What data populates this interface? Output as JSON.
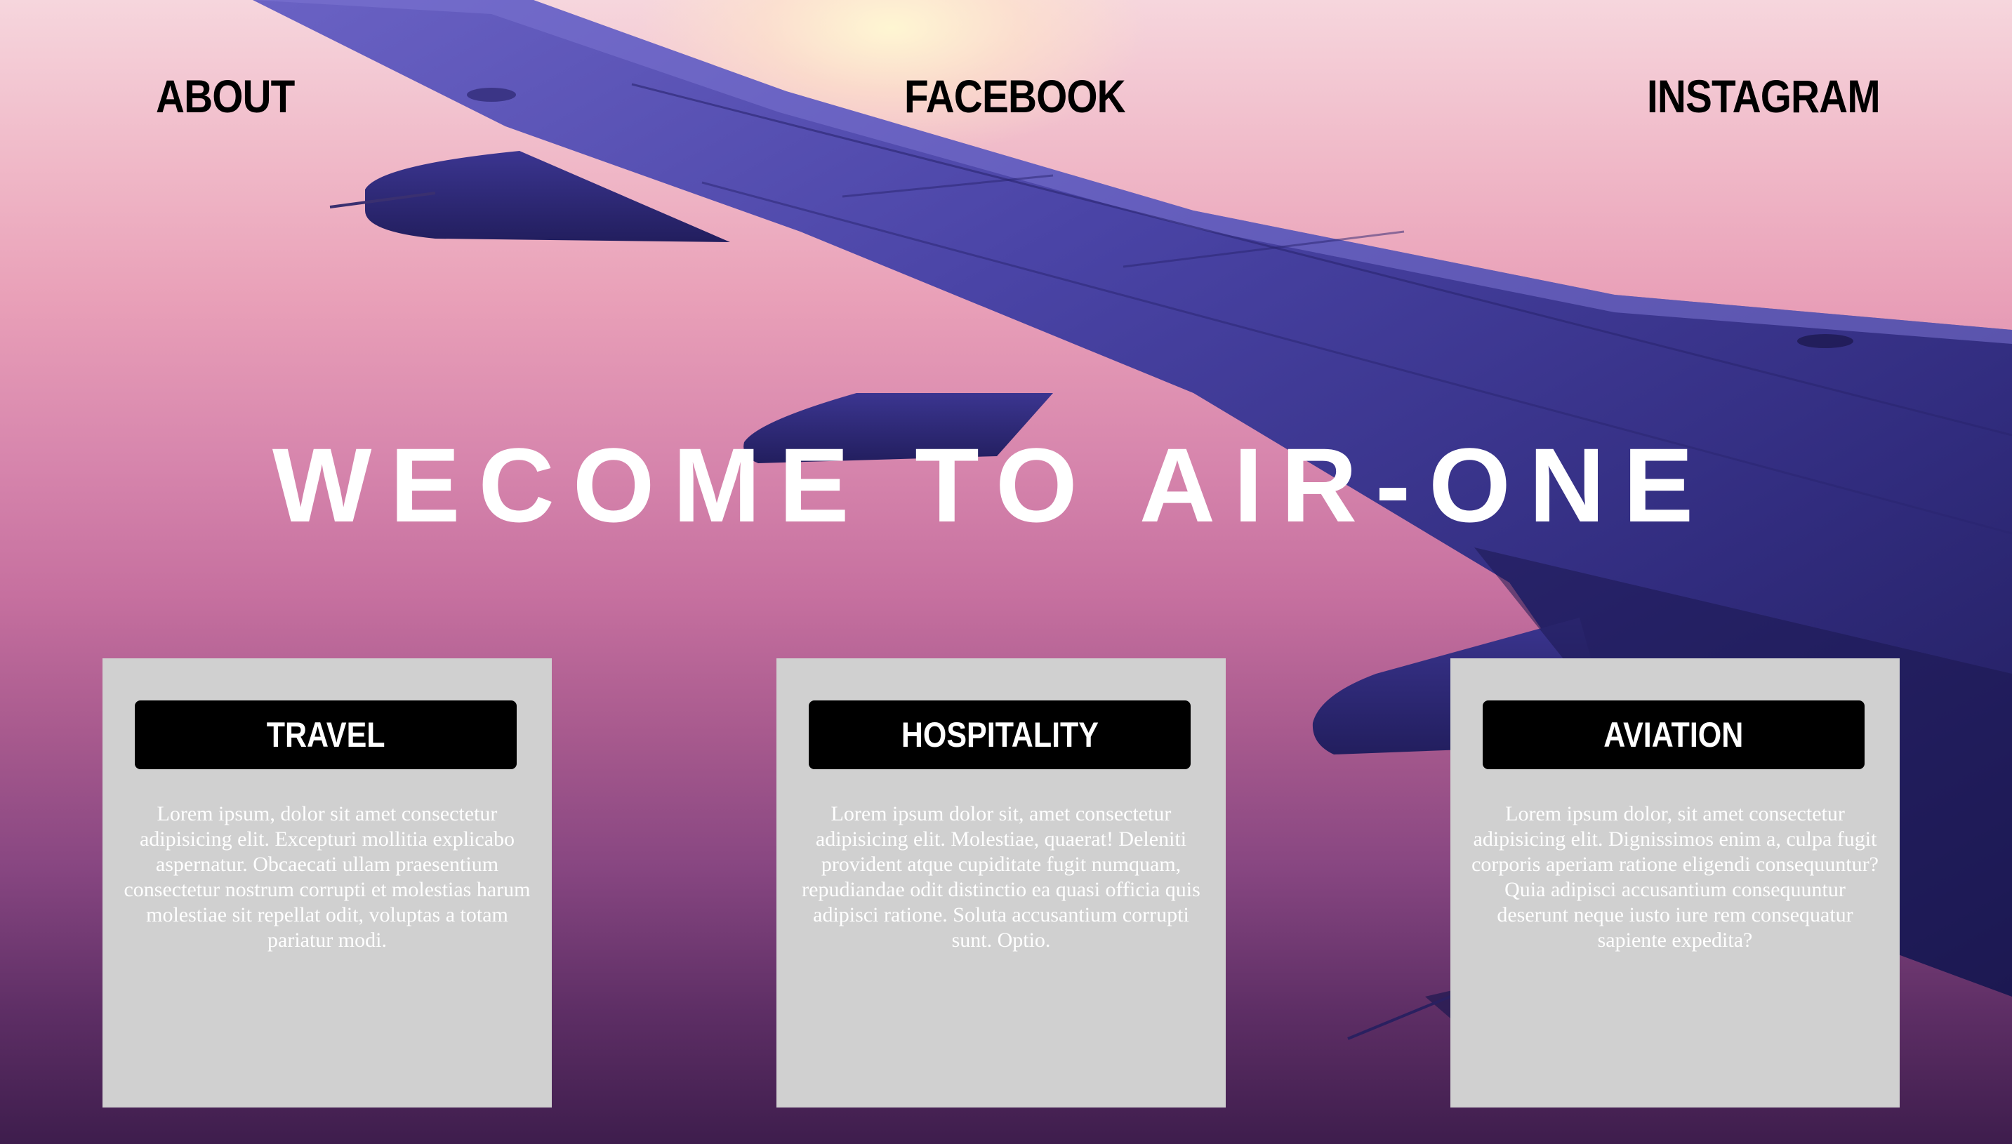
{
  "nav": {
    "about": "ABOUT",
    "facebook": "FACEBOOK",
    "instagram": "INSTAGRAM"
  },
  "hero": {
    "title": "WECOME TO AIR-ONE",
    "background_image": "airplane-wing-sunset"
  },
  "cards": [
    {
      "button_label": "TRAVEL",
      "text": "Lorem ipsum, dolor sit amet consectetur adipisicing elit. Excepturi mollitia explicabo aspernatur. Obcaecati ullam praesentium consectetur nostrum corrupti et molestias harum molestiae sit repellat odit, voluptas a totam pariatur modi."
    },
    {
      "button_label": "HOSPITALITY",
      "text": "Lorem ipsum dolor sit, amet consectetur adipisicing elit. Molestiae, quaerat! Deleniti provident atque cupiditate fugit numquam, repudiandae odit distinctio ea quasi officia quis adipisci ratione. Soluta accusantium corrupti sunt. Optio."
    },
    {
      "button_label": "AVIATION",
      "text": "Lorem ipsum dolor, sit amet consectetur adipisicing elit. Dignissimos enim a, culpa fugit corporis aperiam ratione eligendi consequuntur? Quia adipisci accusantium consequuntur deserunt neque iusto iure rem consequatur sapiente expedita?"
    }
  ],
  "colors": {
    "nav_text": "#000000",
    "hero_text": "#ffffff",
    "card_background": "#d0d0d0",
    "card_button": "#000000",
    "card_text": "#ffffff"
  }
}
